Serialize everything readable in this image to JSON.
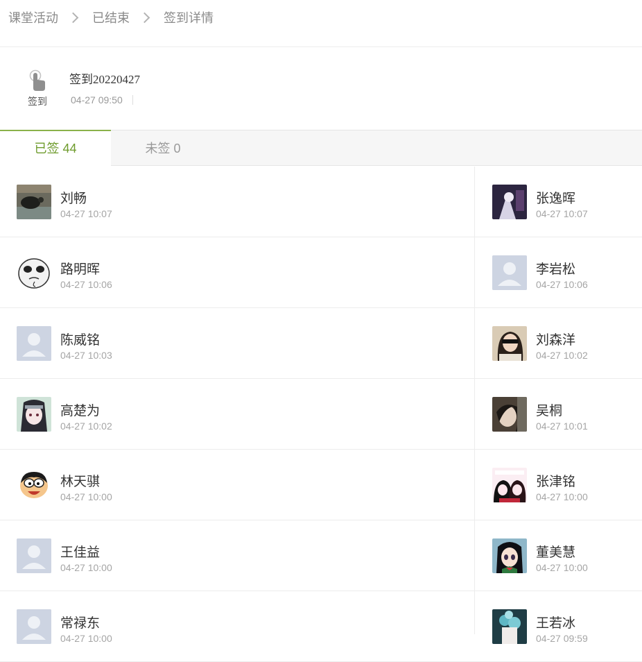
{
  "breadcrumb": [
    "课堂活动",
    "已结束",
    "签到详情"
  ],
  "activity": {
    "icon_label": "签到",
    "title": "签到20220427",
    "time": "04-27 09:50"
  },
  "tabs": {
    "signed": "已签 44",
    "unsigned": "未签 0"
  },
  "rows": [
    {
      "left": {
        "name": "刘畅",
        "time": "04-27 10:07",
        "avatar": "photo-dark"
      },
      "right": {
        "name": "张逸晖",
        "time": "04-27 10:07",
        "avatar": "photo-purple"
      }
    },
    {
      "left": {
        "name": "路明晖",
        "time": "04-27 10:06",
        "avatar": "meme-face"
      },
      "right": {
        "name": "李岩松",
        "time": "04-27 10:06",
        "avatar": "default"
      }
    },
    {
      "left": {
        "name": "陈威铭",
        "time": "04-27 10:03",
        "avatar": "default"
      },
      "right": {
        "name": "刘森洋",
        "time": "04-27 10:02",
        "avatar": "photo-girl"
      }
    },
    {
      "left": {
        "name": "高楚为",
        "time": "04-27 10:02",
        "avatar": "photo-anime"
      },
      "right": {
        "name": "吴桐",
        "time": "04-27 10:01",
        "avatar": "photo-portrait"
      }
    },
    {
      "left": {
        "name": "林天骐",
        "time": "04-27 10:00",
        "avatar": "cartoon-boy"
      },
      "right": {
        "name": "张津铭",
        "time": "04-27 10:00",
        "avatar": "photo-anime-pink"
      }
    },
    {
      "left": {
        "name": "王佳益",
        "time": "04-27 10:00",
        "avatar": "default"
      },
      "right": {
        "name": "董美慧",
        "time": "04-27 10:00",
        "avatar": "anime-girl"
      }
    },
    {
      "left": {
        "name": "常禄东",
        "time": "04-27 10:00",
        "avatar": "default"
      },
      "right": {
        "name": "王若冰",
        "time": "04-27 09:59",
        "avatar": "photo-flowers"
      }
    }
  ]
}
